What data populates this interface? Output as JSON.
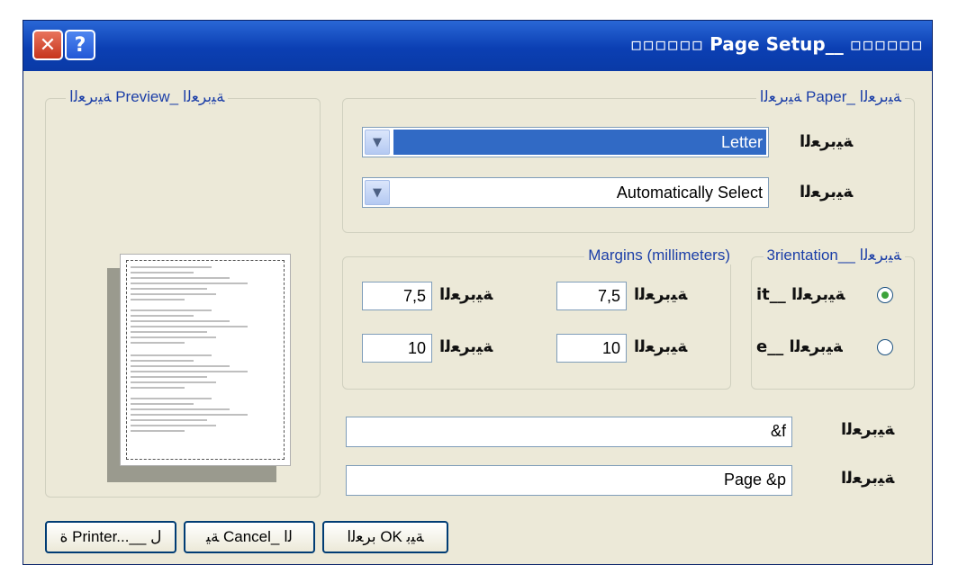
{
  "window": {
    "title": "▫▫▫▫▫▫ Page Setup__ ▫▫▫▫▫▫",
    "close_icon": "close-icon",
    "help_label": "?"
  },
  "preview": {
    "legend": "ﺔﻴﺑﺮﻌﻟﺍ Preview_ ﺔﻴﺑﺮﻌﻟﺍ"
  },
  "paper": {
    "legend": "ﺔﻴﺑﺮﻌﻟﺍ Paper_ ﺔﻴﺑﺮﻌﻟﺍ",
    "size_label": "ﺔﻴﺑﺮﻌﻟﺍ",
    "size_value": "Letter",
    "source_label": "ﺔﻴﺑﺮﻌﻟﺍ",
    "source_value": "Automatically Select"
  },
  "margins": {
    "legend": "Margins (millimeters)",
    "left_label": "ﺔﻴﺑﺮﻌﻟﺍ",
    "left_value": "7,5",
    "right_label": "ﺔﻴﺑﺮﻌﻟﺍ",
    "right_value": "7,5",
    "top_label": "ﺔﻴﺑﺮﻌﻟﺍ",
    "top_value": "10",
    "bottom_label": "ﺔﻴﺑﺮﻌﻟﺍ",
    "bottom_value": "10"
  },
  "orientation": {
    "legend": "3rientation__ ﺔﻴﺑﺮﻌﻟﺍ",
    "portrait_label": "it__ ﺔﻴﺑﺮﻌﻟﺍ",
    "landscape_label": "e__ ﺔﻴﺑﺮﻌﻟﺍ"
  },
  "headers": {
    "header_label": "ﺔﻴﺑﺮﻌﻟﺍ",
    "header_value": "&f",
    "footer_label": "ﺔﻴﺑﺮﻌﻟﺍ",
    "footer_value": "Page &p"
  },
  "buttons": {
    "printer": "ﺓ Printer...__ ﻝ",
    "cancel": "ﺔﻴ Cancel_ ﻟﺍ",
    "ok": "ﺑﺮﻌﻟﺍ OK ﺔﻴﺑ"
  }
}
